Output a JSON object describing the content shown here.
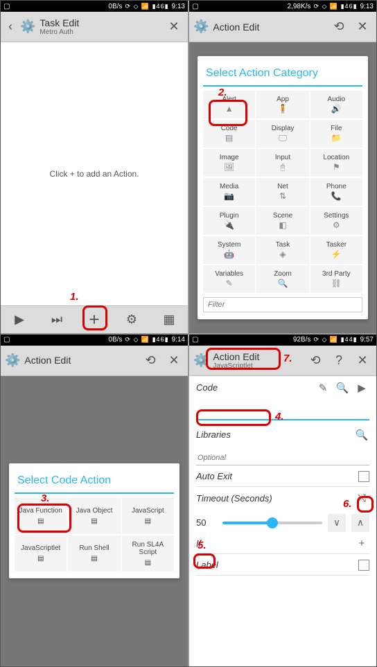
{
  "panel1": {
    "status": {
      "rate": "0B/s",
      "time": "9:13"
    },
    "title": "Task Edit",
    "subtitle": "Metro Auth",
    "hint": "Click + to add an Action.",
    "annot_num": "1."
  },
  "panel2": {
    "status": {
      "rate": "2,98K/s",
      "time": "9:13"
    },
    "title": "Action Edit",
    "dialog_title": "Select Action Category",
    "categories": [
      "Alert",
      "App",
      "Audio",
      "Code",
      "Display",
      "File",
      "Image",
      "Input",
      "Location",
      "Media",
      "Net",
      "Phone",
      "Plugin",
      "Scene",
      "Settings",
      "System",
      "Task",
      "Tasker",
      "Variables",
      "Zoom",
      "3rd Party"
    ],
    "cat_icons": [
      "▲",
      "🧍",
      "🔊",
      "▤",
      "🖵",
      "📁",
      "🖼",
      "🖰",
      "⚑",
      "📷",
      "⇅",
      "📞",
      "🔌",
      "◧",
      "⚙",
      "🤖",
      "◈",
      "⚡",
      "✎",
      "🔍",
      "⛓"
    ],
    "filter_ph": "Filter",
    "annot_num": "2."
  },
  "panel3": {
    "status": {
      "rate": "0B/s",
      "time": "9:14"
    },
    "title": "Action Edit",
    "dialog_title": "Select Code Action",
    "actions": [
      "Java Function",
      "Java Object",
      "JavaScript",
      "JavaScriptlet",
      "Run Shell",
      "Run SL4A Script"
    ],
    "annot_num": "3."
  },
  "panel4": {
    "status": {
      "rate": "92B/s",
      "time": "9:57",
      "batt": "44"
    },
    "title": "Action Edit",
    "subtitle": "JavaScriptlet",
    "code_label": "Code",
    "libs_label": "Libraries",
    "libs_ph": "Optional",
    "autoexit_label": "Auto Exit",
    "timeout_label": "Timeout (Seconds)",
    "timeout_val": "50",
    "if_label": "If",
    "label_label": "Label",
    "annot4": "4.",
    "annot5": "5.",
    "annot6": "6.",
    "annot7": "7."
  },
  "sb_icons": "⟳ ◇ 📶 ▮46▮"
}
